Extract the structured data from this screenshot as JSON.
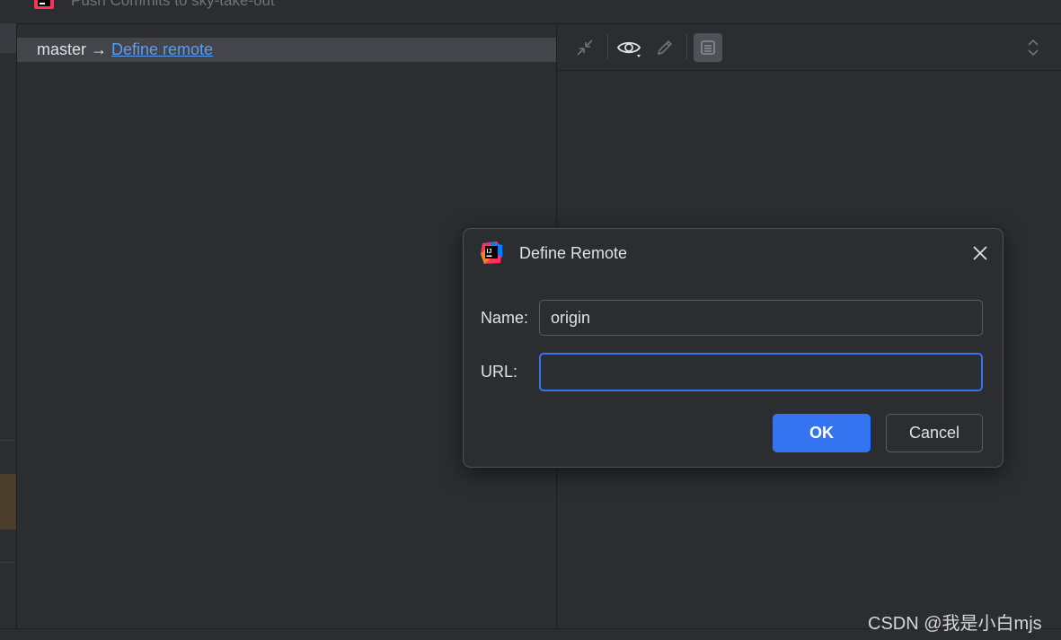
{
  "window": {
    "title": "Push Commits to sky-take-out"
  },
  "commits": {
    "branch": "master",
    "arrow": "→",
    "define_remote_link": "Define remote"
  },
  "details_toolbar": {
    "icons": [
      "collapse-icon",
      "eye-icon",
      "pencil-icon",
      "details-view-icon",
      "expand-collapse-icon"
    ]
  },
  "dialog": {
    "title": "Define Remote",
    "name_label": "Name:",
    "name_value": "origin",
    "url_label": "URL:",
    "url_value": "",
    "ok_label": "OK",
    "cancel_label": "Cancel"
  },
  "watermark": "CSDN @我是小白mjs",
  "colors": {
    "background": "#2b2d30",
    "accent": "#3574f0",
    "link": "#589df6",
    "selection": "#43454a"
  }
}
